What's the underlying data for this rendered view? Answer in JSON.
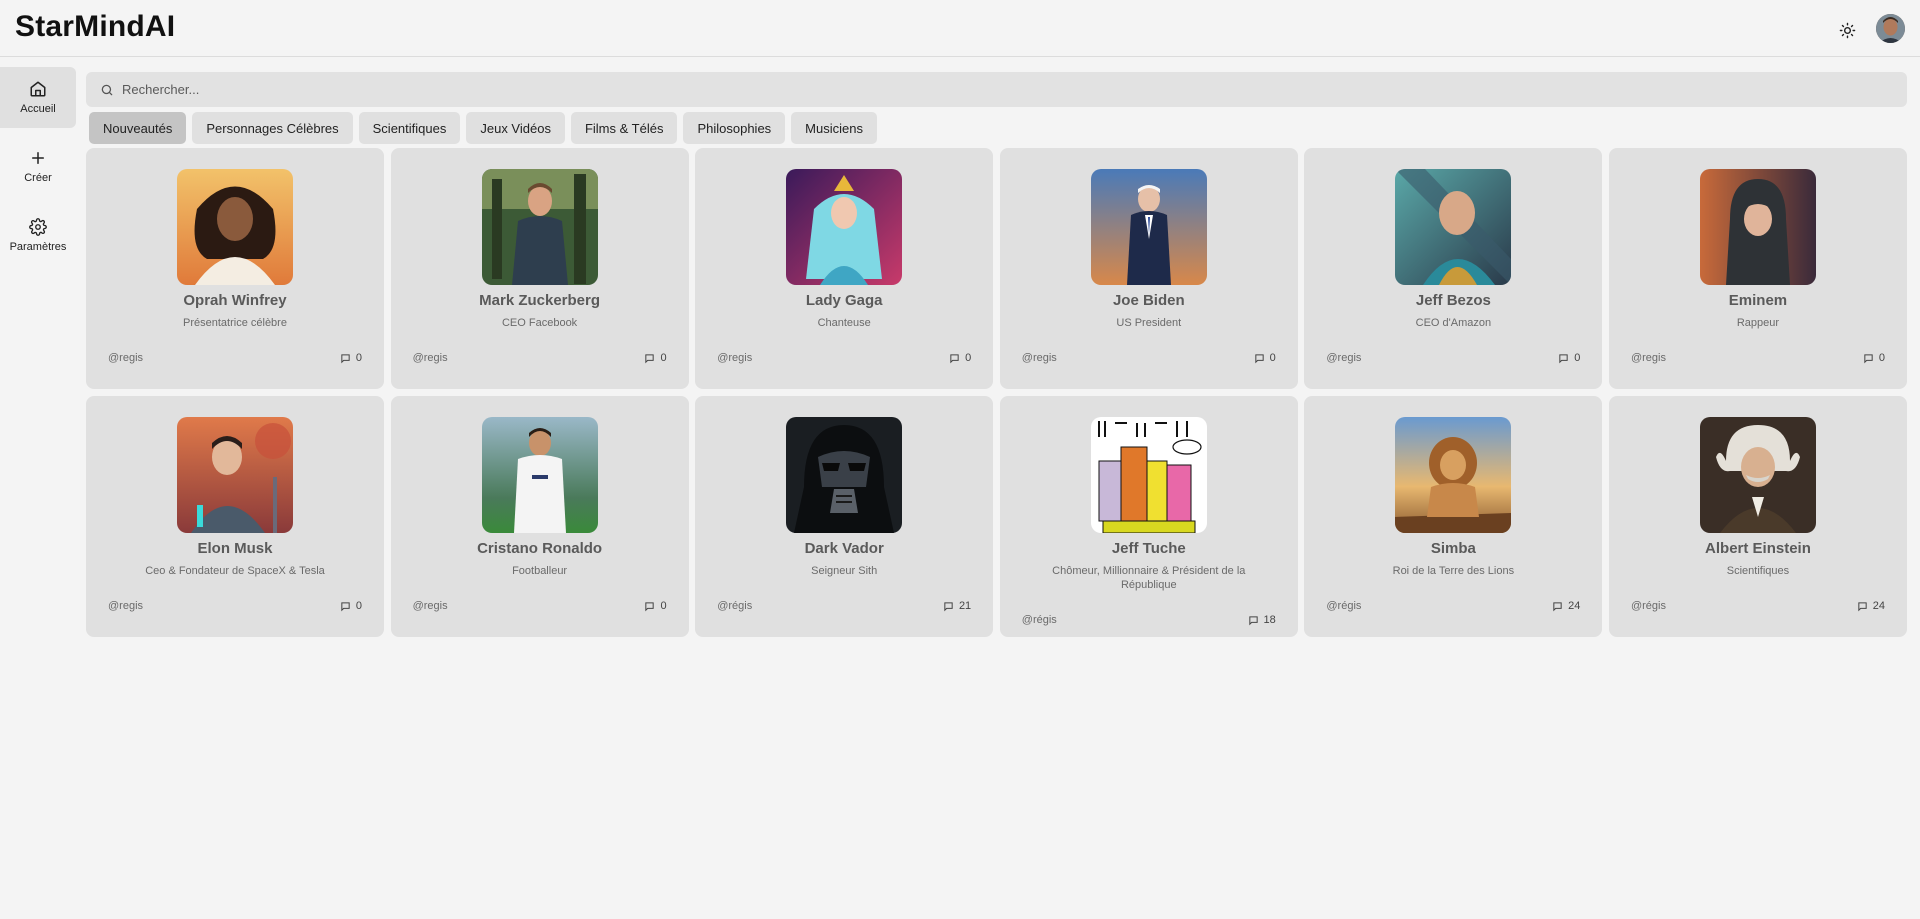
{
  "app": {
    "title": "StarMindAI"
  },
  "sidebar": {
    "items": [
      {
        "label": "Accueil",
        "icon": "home-icon"
      },
      {
        "label": "Créer",
        "icon": "plus-icon"
      },
      {
        "label": "Paramètres",
        "icon": "gear-icon"
      }
    ]
  },
  "search": {
    "placeholder": "Rechercher..."
  },
  "tabs": [
    "Nouveautés",
    "Personnages Célèbres",
    "Scientifiques",
    "Jeux Vidéos",
    "Films & Télés",
    "Philosophies",
    "Musiciens"
  ],
  "cards": [
    {
      "name": "Oprah Winfrey",
      "description": "Présentatrice célèbre",
      "author": "@regis",
      "count": "0"
    },
    {
      "name": "Mark Zuckerberg",
      "description": "CEO Facebook",
      "author": "@regis",
      "count": "0"
    },
    {
      "name": "Lady Gaga",
      "description": "Chanteuse",
      "author": "@regis",
      "count": "0"
    },
    {
      "name": "Joe Biden",
      "description": "US President",
      "author": "@regis",
      "count": "0"
    },
    {
      "name": "Jeff Bezos",
      "description": "CEO d'Amazon",
      "author": "@regis",
      "count": "0"
    },
    {
      "name": "Eminem",
      "description": "Rappeur",
      "author": "@regis",
      "count": "0"
    },
    {
      "name": "Elon Musk",
      "description": "Ceo & Fondateur de SpaceX & Tesla",
      "author": "@regis",
      "count": "0"
    },
    {
      "name": "Cristano Ronaldo",
      "description": "Footballeur",
      "author": "@regis",
      "count": "0"
    },
    {
      "name": "Dark Vador",
      "description": "Seigneur Sith",
      "author": "@régis",
      "count": "21"
    },
    {
      "name": "Jeff Tuche",
      "description": "Chômeur, Millionnaire & Président de la République",
      "author": "@régis",
      "count": "18"
    },
    {
      "name": "Simba",
      "description": "Roi de la Terre des Lions",
      "author": "@régis",
      "count": "24"
    },
    {
      "name": "Albert Einstein",
      "description": "Scientifiques",
      "author": "@régis",
      "count": "24"
    }
  ]
}
